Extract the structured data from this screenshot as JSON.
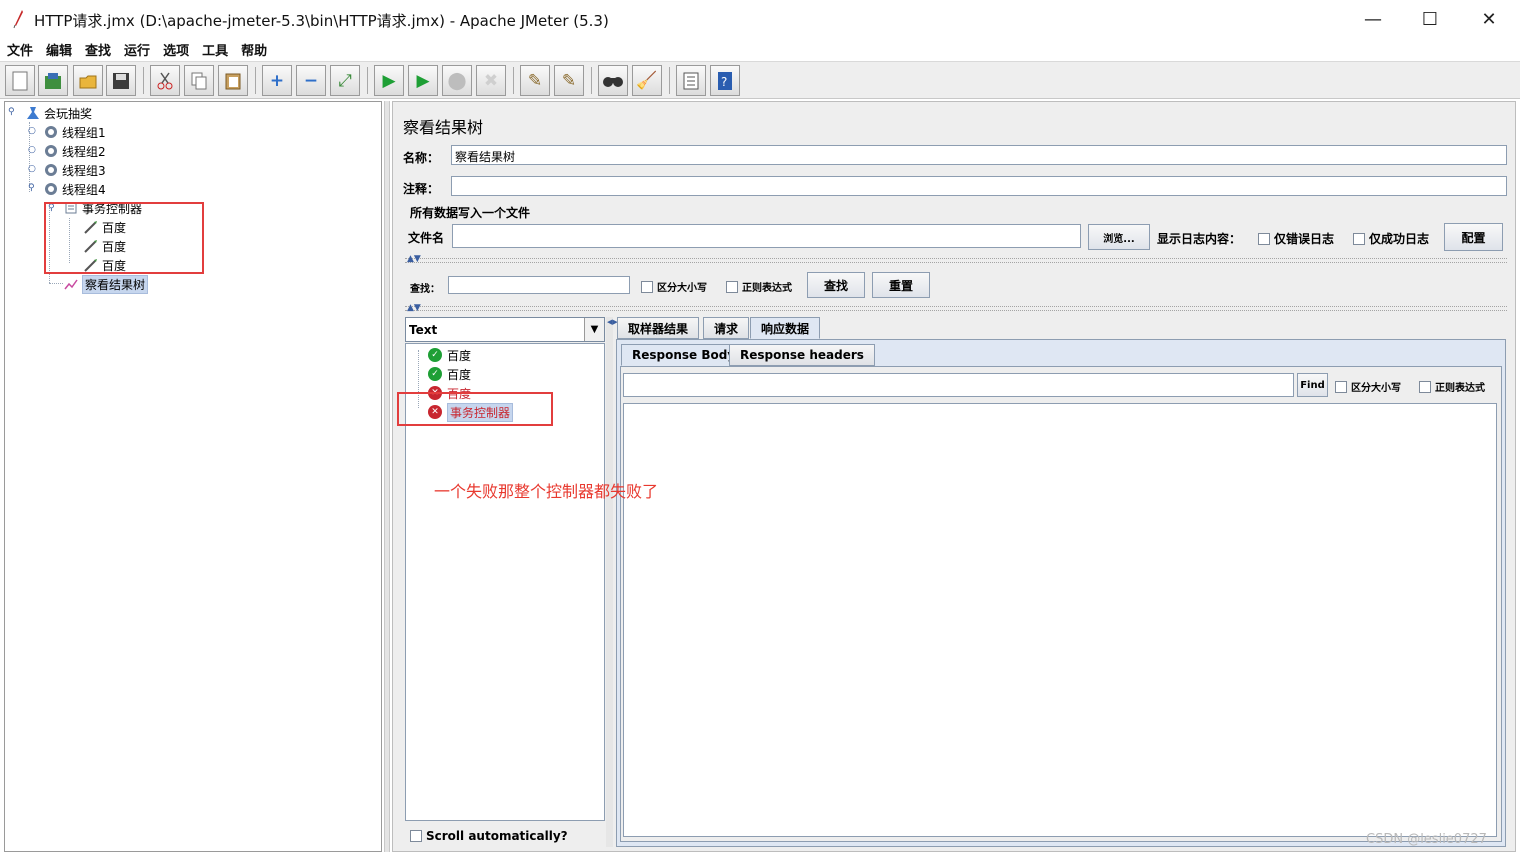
{
  "window": {
    "title": "HTTP请求.jmx (D:\\apache-jmeter-5.3\\bin\\HTTP请求.jmx) - Apache JMeter (5.3)",
    "minimize": "—",
    "maximize": "☐",
    "close": "✕"
  },
  "menu": [
    "文件",
    "编辑",
    "查找",
    "运行",
    "选项",
    "工具",
    "帮助"
  ],
  "toolbar": {
    "icons": [
      "new-icon",
      "templates-icon",
      "open-icon",
      "save-icon",
      "cut-icon",
      "copy-icon",
      "paste-icon",
      "expand-icon",
      "collapse-icon",
      "toggle-icon",
      "start-icon",
      "start-no-pause-icon",
      "stop-icon",
      "shutdown-icon",
      "clear-icon",
      "clear-all-icon",
      "search-icon",
      "reset-search-icon",
      "function-helper-icon",
      "help-icon"
    ]
  },
  "tree": {
    "root": "会玩抽奖",
    "groups": [
      "线程组1",
      "线程组2",
      "线程组3",
      "线程组4"
    ],
    "controller": "事务控制器",
    "samplers": [
      "百度",
      "百度",
      "百度"
    ],
    "listener": "察看结果树"
  },
  "panel": {
    "title": "察看结果树",
    "name_label": "名称：",
    "name_value": "察看结果树",
    "comment_label": "注释：",
    "comment_value": "",
    "file_section": "所有数据写入一个文件",
    "filename_label": "文件名",
    "filename_value": "",
    "browse": "浏览...",
    "log_label": "显示日志内容：",
    "errors_only": "仅错误日志",
    "success_only": "仅成功日志",
    "configure": "配置",
    "search_label": "查找：",
    "case_sensitive": "区分大小写",
    "regex": "正则表达式",
    "find_btn": "查找",
    "reset_btn": "重置"
  },
  "results": {
    "renderer": "Text",
    "items": [
      {
        "label": "百度",
        "status": "ok"
      },
      {
        "label": "百度",
        "status": "ok"
      },
      {
        "label": "百度",
        "status": "fail"
      },
      {
        "label": "事务控制器",
        "status": "fail"
      }
    ],
    "scroll_label": "Scroll automatically?"
  },
  "tabs": {
    "main": [
      "取样器结果",
      "请求",
      "响应数据"
    ],
    "sub": [
      "Response Body",
      "Response headers"
    ],
    "find_btn": "Find",
    "case_sensitive": "区分大小写",
    "regex": "正则表达式"
  },
  "annotation": "一个失败那整个控制器都失败了",
  "watermark": "CSDN @leslie0727"
}
